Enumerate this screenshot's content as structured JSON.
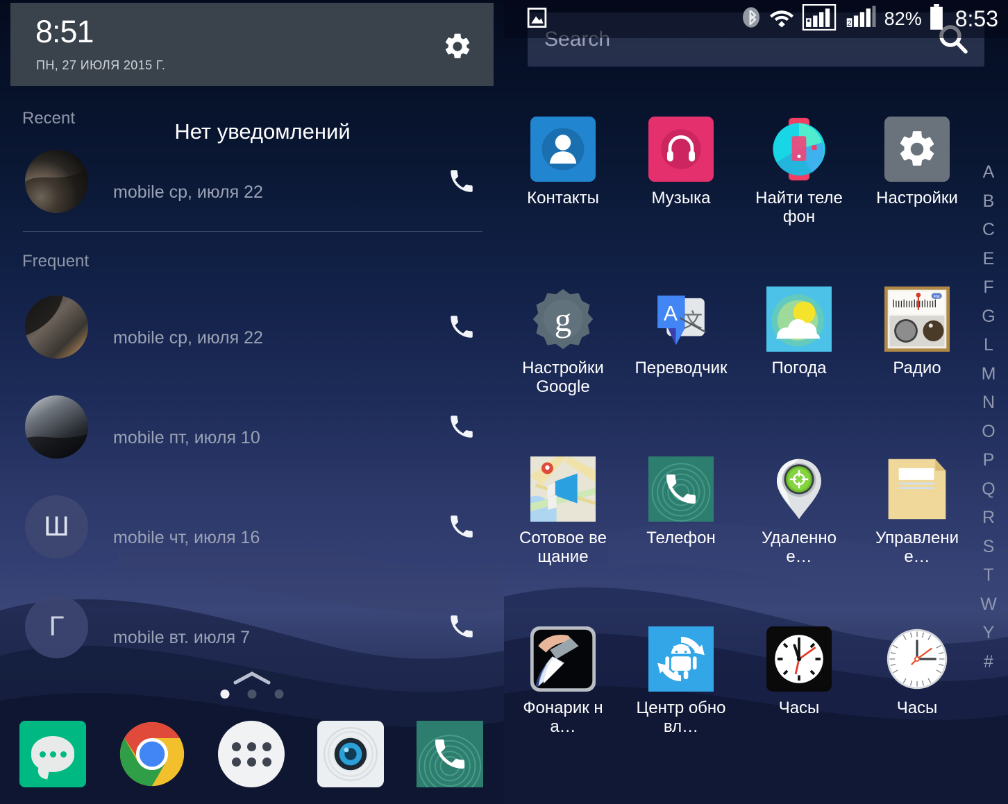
{
  "left_panel": {
    "notification_shade": {
      "time": "8:51",
      "date": "ПН, 27 ИЮЛЯ 2015 Г.",
      "settings_icon": "gear-icon",
      "empty_text": "Нет уведомлений"
    },
    "sections": {
      "recent_label": "Recent",
      "frequent_label": "Frequent"
    },
    "recent_contacts": [
      {
        "avatar_type": "photo",
        "avatar_letter": "",
        "subtitle": "mobile ср, июля 22",
        "action_icon": "phone-call-icon"
      }
    ],
    "frequent_contacts": [
      {
        "avatar_type": "photo",
        "avatar_letter": "",
        "subtitle": "mobile ср, июля 22",
        "action_icon": "phone-call-icon"
      },
      {
        "avatar_type": "photo",
        "avatar_letter": "",
        "subtitle": "mobile пт, июля 10",
        "action_icon": "phone-call-icon"
      },
      {
        "avatar_type": "letter",
        "avatar_letter": "Ш",
        "subtitle": "mobile чт, июля 16",
        "action_icon": "phone-call-icon"
      },
      {
        "avatar_type": "letter",
        "avatar_letter": "Г",
        "subtitle": "mobile вт. июля 7",
        "action_icon": "phone-call-icon"
      }
    ],
    "page_indicator": {
      "pages": 3,
      "active": 1,
      "arrow_icon": "chevron-up-icon"
    },
    "dock": [
      {
        "name": "messaging-icon",
        "label": ""
      },
      {
        "name": "chrome-icon",
        "label": ""
      },
      {
        "name": "app-drawer-icon",
        "label": ""
      },
      {
        "name": "camera-icon",
        "label": ""
      },
      {
        "name": "phone-icon",
        "label": ""
      }
    ]
  },
  "right_panel": {
    "status_bar": {
      "left_icons": [
        "image-icon"
      ],
      "right_icons": [
        "bluetooth-icon",
        "wifi-icon",
        "signal-sim1-icon",
        "signal-sim2-icon",
        "battery-icon"
      ],
      "battery_percent": "82%",
      "time": "8:53"
    },
    "search": {
      "placeholder": "Search",
      "icon": "search-icon"
    },
    "apps": [
      {
        "label": "Контакты",
        "icon": "contacts-icon"
      },
      {
        "label": "Музыка",
        "icon": "music-icon"
      },
      {
        "label": "Найти телефон",
        "icon": "find-phone-icon"
      },
      {
        "label": "Настройки",
        "icon": "settings-gear-icon"
      },
      {
        "label": "Настройки Google",
        "icon": "google-settings-icon"
      },
      {
        "label": "Переводчик",
        "icon": "translate-icon"
      },
      {
        "label": "Погода",
        "icon": "weather-icon"
      },
      {
        "label": "Радио",
        "icon": "radio-icon"
      },
      {
        "label": "Сотовое вещание",
        "icon": "cell-broadcast-icon"
      },
      {
        "label": "Телефон",
        "icon": "phone-dialer-icon"
      },
      {
        "label": "Удаленное…",
        "icon": "remote-location-icon"
      },
      {
        "label": "Управление…",
        "icon": "file-manager-icon"
      },
      {
        "label": "Фонарик на…",
        "icon": "flashlight-icon"
      },
      {
        "label": "Центр обновл…",
        "icon": "update-center-icon"
      },
      {
        "label": "Часы",
        "icon": "clock-black-icon"
      },
      {
        "label": "Часы",
        "icon": "clock-white-icon"
      }
    ],
    "alphabet_index": [
      "A",
      "B",
      "C",
      "E",
      "F",
      "G",
      "L",
      "M",
      "N",
      "O",
      "P",
      "Q",
      "R",
      "S",
      "T",
      "W",
      "Y",
      "#"
    ]
  },
  "colors": {
    "shade_bg": "#3a424b",
    "accent_green": "#00b982",
    "contacts_blue": "#2185d0",
    "music_pink": "#e4306d",
    "settings_gray": "#6a737b",
    "translate_blue": "#4285f4",
    "phone_teal": "#2d7e6e"
  }
}
